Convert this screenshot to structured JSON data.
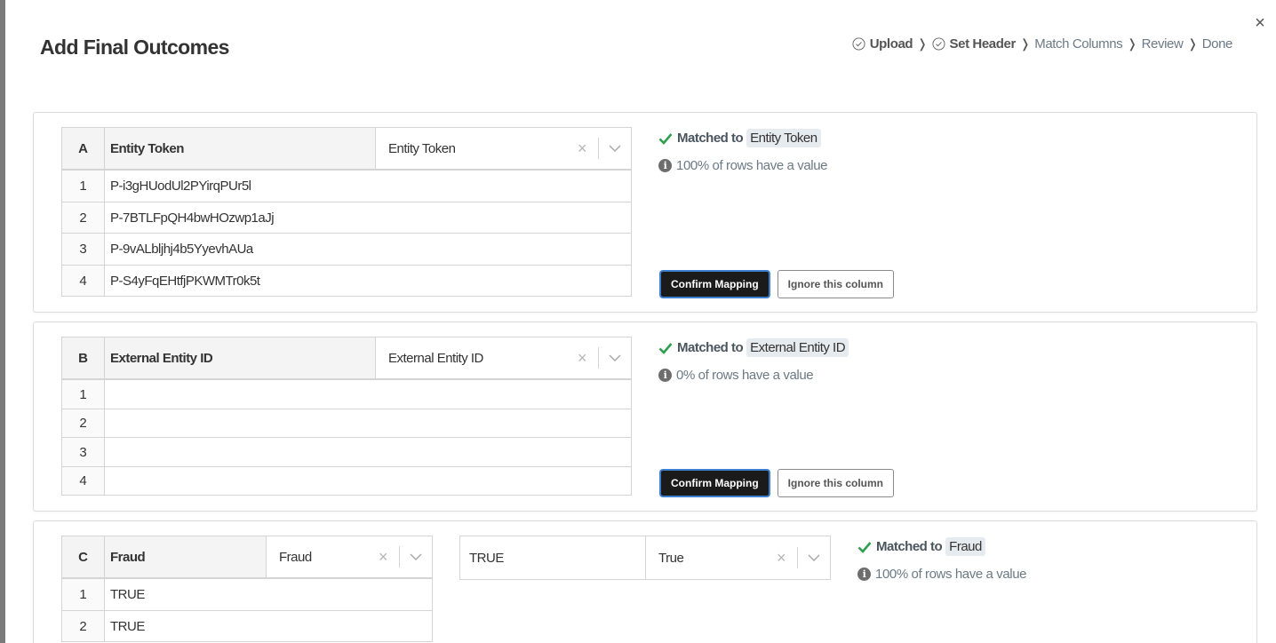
{
  "modal": {
    "title": "Add Final Outcomes",
    "close_label": "×"
  },
  "steps": [
    {
      "label": "Upload",
      "done": true
    },
    {
      "label": "Set Header",
      "done": true
    },
    {
      "label": "Match Columns",
      "done": false
    },
    {
      "label": "Review",
      "done": false
    },
    {
      "label": "Done",
      "done": false
    }
  ],
  "step_separator": "❭",
  "columns": {
    "a": {
      "letter": "A",
      "header": "Entity Token",
      "selected": "Entity Token",
      "rows": [
        {
          "num": "1",
          "value": "P-i3gHUodUl2PYirqPUr5l"
        },
        {
          "num": "2",
          "value": "P-7BTLFpQH4bwHOzwp1aJj"
        },
        {
          "num": "3",
          "value": "P-9vALbljhj4b5YyevhAUa"
        },
        {
          "num": "4",
          "value": "P-S4yFqEHtfjPKWMTr0k5t"
        }
      ],
      "matched_prefix": "Matched to",
      "matched_to": "Entity Token",
      "pct_text": "100% of rows have a value",
      "confirm_label": "Confirm Mapping",
      "ignore_label": "Ignore this column"
    },
    "b": {
      "letter": "B",
      "header": "External Entity ID",
      "selected": "External Entity ID",
      "rows": [
        {
          "num": "1",
          "value": ""
        },
        {
          "num": "2",
          "value": ""
        },
        {
          "num": "3",
          "value": ""
        },
        {
          "num": "4",
          "value": ""
        }
      ],
      "matched_prefix": "Matched to",
      "matched_to": "External Entity ID",
      "pct_text": "0% of rows have a value",
      "confirm_label": "Confirm Mapping",
      "ignore_label": "Ignore this column"
    },
    "c": {
      "letter": "C",
      "header": "Fraud",
      "selected": "Fraud",
      "rows": [
        {
          "num": "1",
          "value": "TRUE"
        },
        {
          "num": "2",
          "value": "TRUE"
        }
      ],
      "value_map": {
        "source": "TRUE",
        "target": "True"
      },
      "matched_prefix": "Matched to",
      "matched_to": "Fraud",
      "pct_text": "100% of rows have a value"
    }
  },
  "icons": {
    "clear": "×",
    "info": "i"
  },
  "colors": {
    "check_green": "#2e9e4f",
    "confirm_bg": "#1b1b1b",
    "confirm_border": "#3d7fcf"
  }
}
